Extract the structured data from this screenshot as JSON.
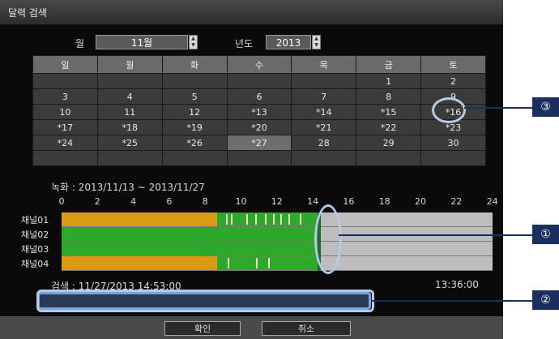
{
  "window": {
    "title": "달력 검색"
  },
  "month_label": "월",
  "month_value": "11월",
  "year_label": "년도",
  "year_value": "2013",
  "calendar": {
    "weekdays": [
      "일",
      "월",
      "화",
      "수",
      "목",
      "금",
      "토"
    ],
    "weeks": [
      [
        "",
        "",
        "",
        "",
        "",
        "1",
        "2"
      ],
      [
        "3",
        "4",
        "5",
        "6",
        "7",
        "8",
        "9"
      ],
      [
        "10",
        "11",
        "12",
        "*13",
        "*14",
        "*15",
        "*16"
      ],
      [
        "*17",
        "*18",
        "*19",
        "*20",
        "*21",
        "*22",
        "*23"
      ],
      [
        "*24",
        "*25",
        "*26",
        "*27",
        "28",
        "29",
        "30"
      ],
      [
        "",
        "",
        "",
        "",
        "",
        "",
        ""
      ]
    ],
    "highlighted": "*27",
    "selected": "*16"
  },
  "recording_range": "녹화 : 2013/11/13 ~ 2013/11/27",
  "timeline": {
    "hours": [
      "0",
      "2",
      "4",
      "6",
      "8",
      "10",
      "12",
      "14",
      "16",
      "18",
      "20",
      "22",
      "24"
    ],
    "channels": [
      "채널01",
      "채널02",
      "채널03",
      "채널04"
    ],
    "colors": {
      "continuous": "#d99a18",
      "event": "#2ea82a",
      "empty": "#bdbdbd",
      "cursor": "#1e6a30"
    }
  },
  "search_time": "검색 : 11/27/2013 14:53:00",
  "end_time": "13:36:00",
  "buttons": {
    "ok": "확인",
    "cancel": "취소"
  },
  "callouts": [
    "①",
    "②",
    "③"
  ]
}
